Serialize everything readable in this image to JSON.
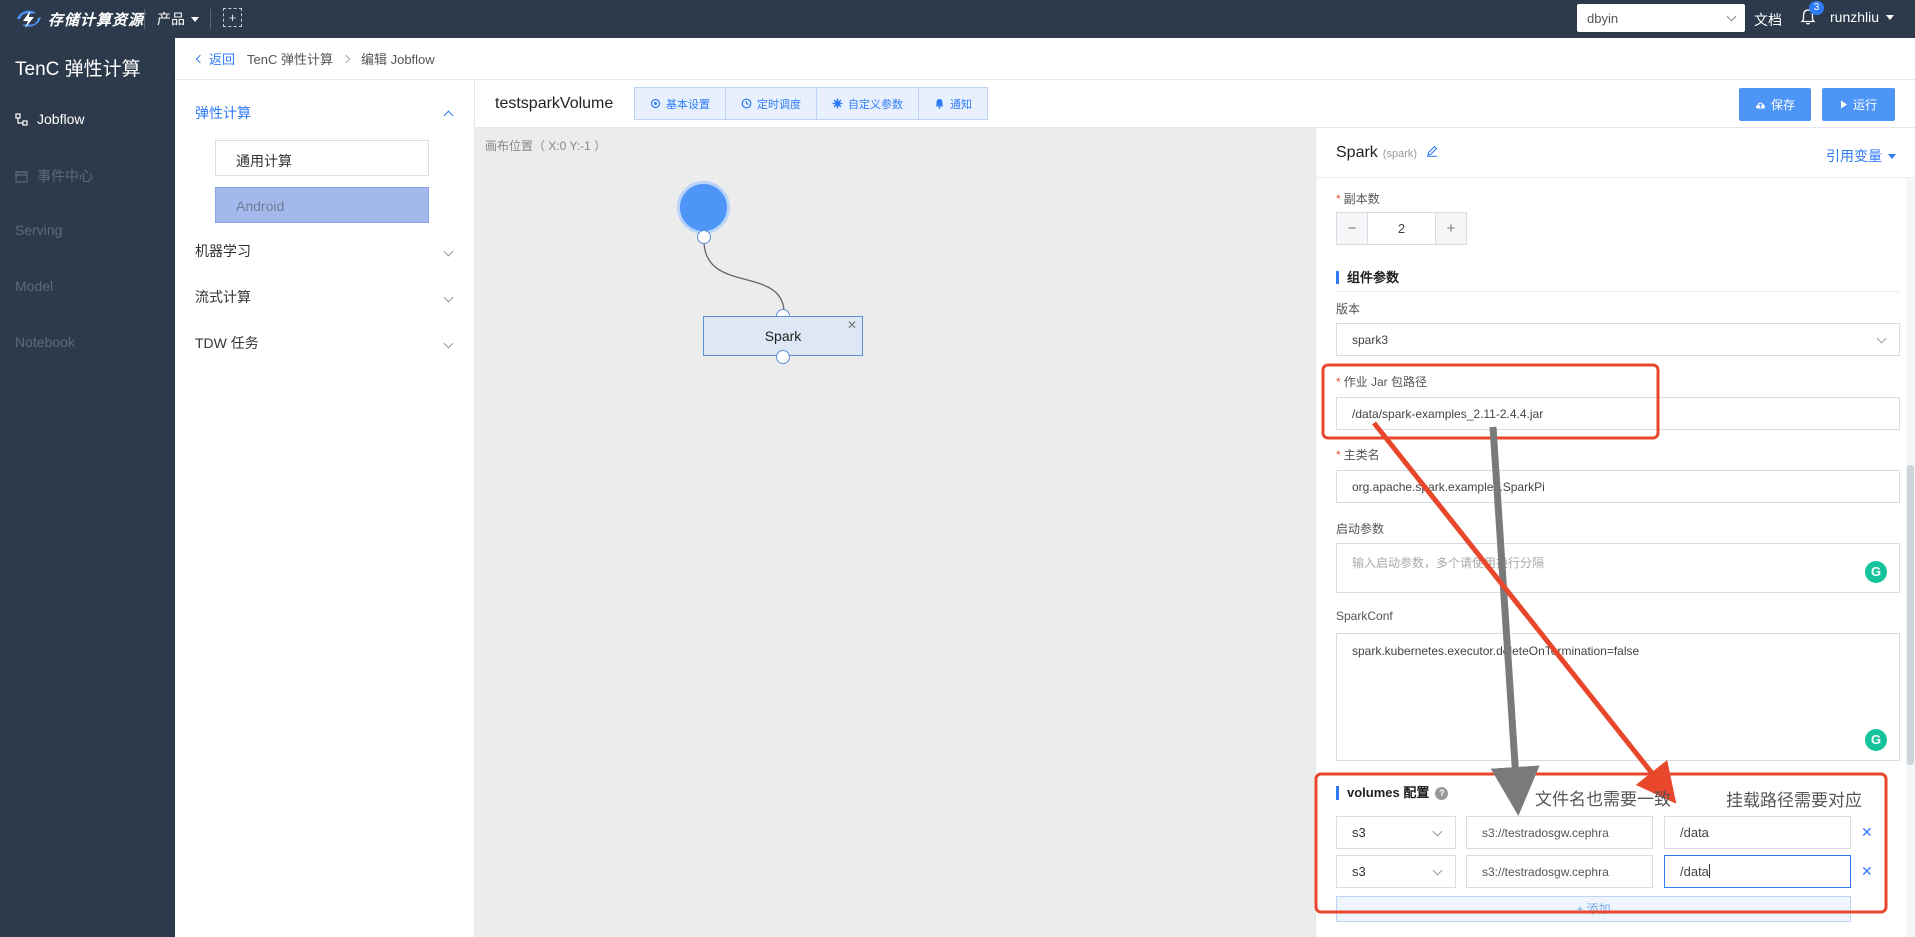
{
  "topbar": {
    "brand": "存储计算资源",
    "product_menu": "产品",
    "project": "dbyin",
    "docs": "文档",
    "notification_count": "3",
    "user": "runzhliu"
  },
  "sidebar": {
    "title": "TenC 弹性计算",
    "items": [
      {
        "label": "Jobflow"
      },
      {
        "label": "事件中心"
      },
      {
        "label": "Serving"
      },
      {
        "label": "Model"
      },
      {
        "label": "Notebook"
      }
    ]
  },
  "breadcrumb": {
    "back": "返回",
    "crumb1": "TenC 弹性计算",
    "crumb2": "编辑 Jobflow"
  },
  "components": {
    "categories": [
      {
        "label": "弹性计算"
      },
      {
        "label": "机器学习"
      },
      {
        "label": "流式计算"
      },
      {
        "label": "TDW 任务"
      }
    ],
    "items": [
      {
        "label": "通用计算"
      },
      {
        "label": "Android"
      }
    ]
  },
  "flow": {
    "name": "testsparkVolume",
    "tabs": [
      {
        "label": "基本设置",
        "icon": "gear-icon"
      },
      {
        "label": "定时调度",
        "icon": "clock-icon"
      },
      {
        "label": "自定义参数",
        "icon": "cog-icon"
      },
      {
        "label": "通知",
        "icon": "bell-icon"
      }
    ],
    "save": "保存",
    "run": "运行"
  },
  "canvas": {
    "position_text": "画布位置（ X:0   Y:-1  ）",
    "node_label": "Spark"
  },
  "config": {
    "title": "Spark",
    "subtitle": "(spark)",
    "ref_var": "引用变量",
    "replicas_label": "副本数",
    "replicas_value": "2",
    "section_params": "组件参数",
    "version_label": "版本",
    "version_value": "spark3",
    "jar_label": "作业 Jar 包路径",
    "jar_value": "/data/spark-examples_2.11-2.4.4.jar",
    "main_class_label": "主类名",
    "main_class_value": "org.apache.spark.examples.SparkPi",
    "args_label": "启动参数",
    "args_placeholder": "输入启动参数，多个请使用换行分隔",
    "sparkconf_label": "SparkConf",
    "sparkconf_value": "spark.kubernetes.executor.deleteOnTermination=false",
    "volumes_label": "volumes 配置",
    "volumes": [
      {
        "type": "s3",
        "source": "s3://testradosgw.cephra",
        "path": "/data"
      },
      {
        "type": "s3",
        "source": "s3://testradosgw.cephra",
        "path": "/data"
      }
    ],
    "add": "+ 添加"
  },
  "annotations": {
    "note_filename": "文件名也需要一致",
    "note_mount": "挂载路径需要对应",
    "highlight_color": "#e8472c",
    "gray_arrow_color": "#7a7a7a"
  }
}
